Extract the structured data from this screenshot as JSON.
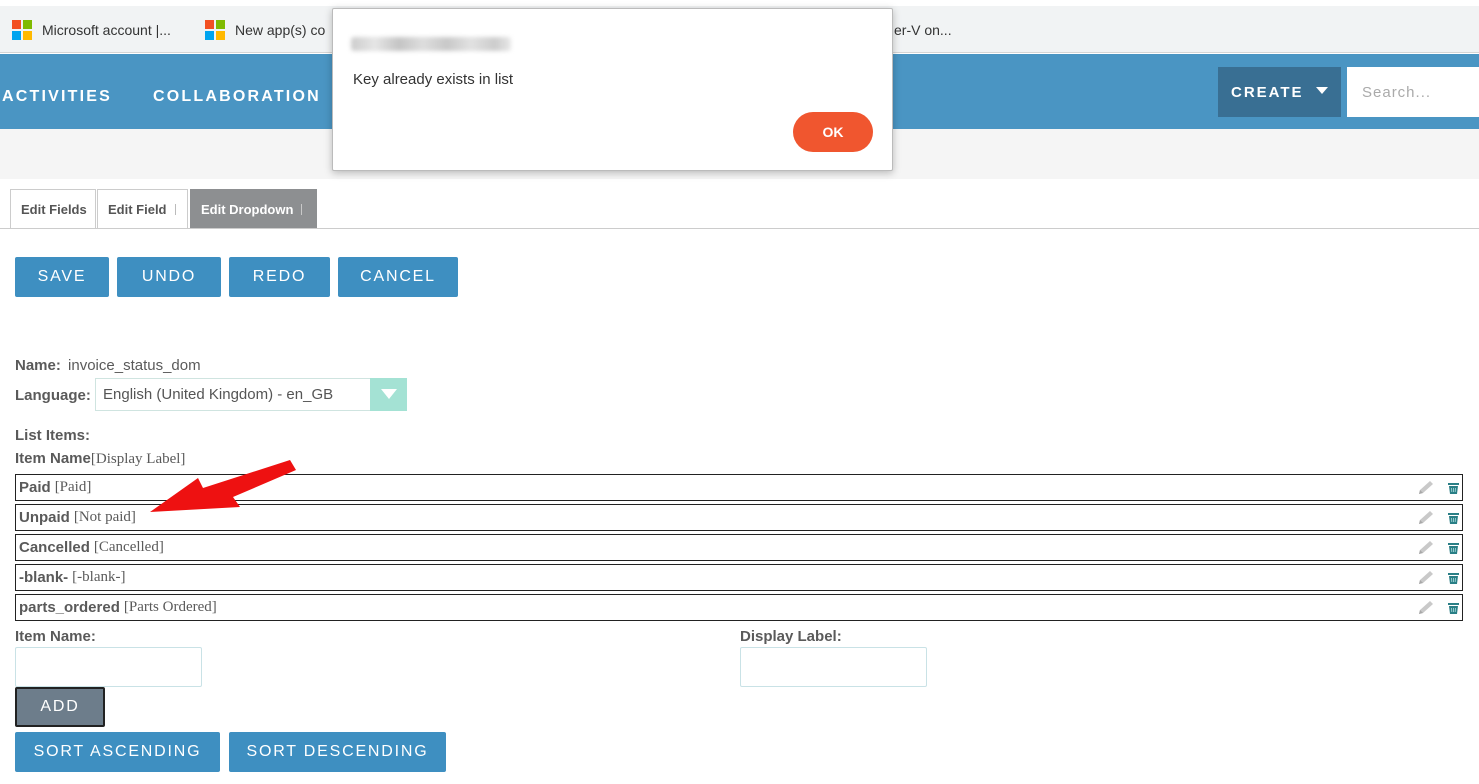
{
  "bookmarks": [
    {
      "label": "Microsoft account |...",
      "icon": "microsoft-logo-icon"
    },
    {
      "label": "New app(s) co",
      "icon": "microsoft-logo-icon"
    },
    {
      "label": "er-V on..."
    }
  ],
  "nav": {
    "items": [
      "ACTIVITIES",
      "COLLABORATION"
    ],
    "create_label": "CREATE",
    "search_placeholder": "Search..."
  },
  "tabs": [
    {
      "label": "Edit Fields",
      "active": false
    },
    {
      "label": "Edit Field",
      "active": false
    },
    {
      "label": "Edit Dropdown",
      "active": true
    }
  ],
  "actions": {
    "save": "SAVE",
    "undo": "UNDO",
    "redo": "REDO",
    "cancel": "CANCEL"
  },
  "form": {
    "name_label": "Name:",
    "name_value": "invoice_status_dom",
    "language_label": "Language:",
    "language_value": "English (United Kingdom) - en_GB",
    "list_items_label": "List Items:",
    "item_name_header": "Item Name",
    "display_label_header": "[Display Label]",
    "item_name_field_label": "Item Name:",
    "display_label_field_label": "Display Label:",
    "add_label": "ADD",
    "sort_asc_label": "SORT ASCENDING",
    "sort_desc_label": "SORT DESCENDING"
  },
  "list_items": [
    {
      "key": "Paid",
      "display": "[Paid]"
    },
    {
      "key": "Unpaid",
      "display": "[Not paid]"
    },
    {
      "key": "Cancelled",
      "display": "[Cancelled]"
    },
    {
      "key": "-blank-",
      "display": "[-blank-]"
    },
    {
      "key": "parts_ordered",
      "display": "[Parts Ordered]"
    }
  ],
  "dialog": {
    "message": "Key already exists in list",
    "ok_label": "OK"
  },
  "colors": {
    "navbar": "#4a95c3",
    "button": "#3e8fc1",
    "ok_button": "#f0562f",
    "annotation_arrow": "#ee1111"
  }
}
